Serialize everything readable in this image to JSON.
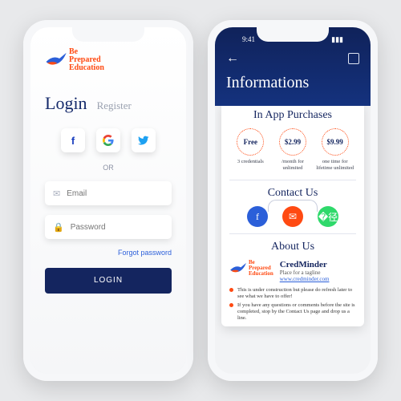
{
  "brand": {
    "line1": "Be",
    "line2": "Prepared",
    "line3": "Education"
  },
  "login": {
    "tab_login": "Login",
    "tab_register": "Register",
    "or": "OR",
    "email_ph": "Email",
    "pass_ph": "Password",
    "forgot": "Forgot password",
    "submit": "LOGIN"
  },
  "info": {
    "time": "9:41",
    "title": "Informations",
    "sect_purchases": "In App Purchases",
    "plans": [
      {
        "price": "Free",
        "desc": "3 credentials"
      },
      {
        "price": "$2.99",
        "desc": "/month for unlimited"
      },
      {
        "price": "$9.99",
        "desc": "one time for lifetime unlimited"
      }
    ],
    "sect_contact": "Contact Us",
    "sect_about": "About Us",
    "about": {
      "name": "CredMinder",
      "tag": "Place for a tagline",
      "url": "www.credminder.com"
    },
    "bullets": [
      "This is under construction but please do refresh later to see what we have to offer!",
      "If you have any questions or comments before the site is completed, stop by the Contact Us page and drop us a line."
    ]
  }
}
